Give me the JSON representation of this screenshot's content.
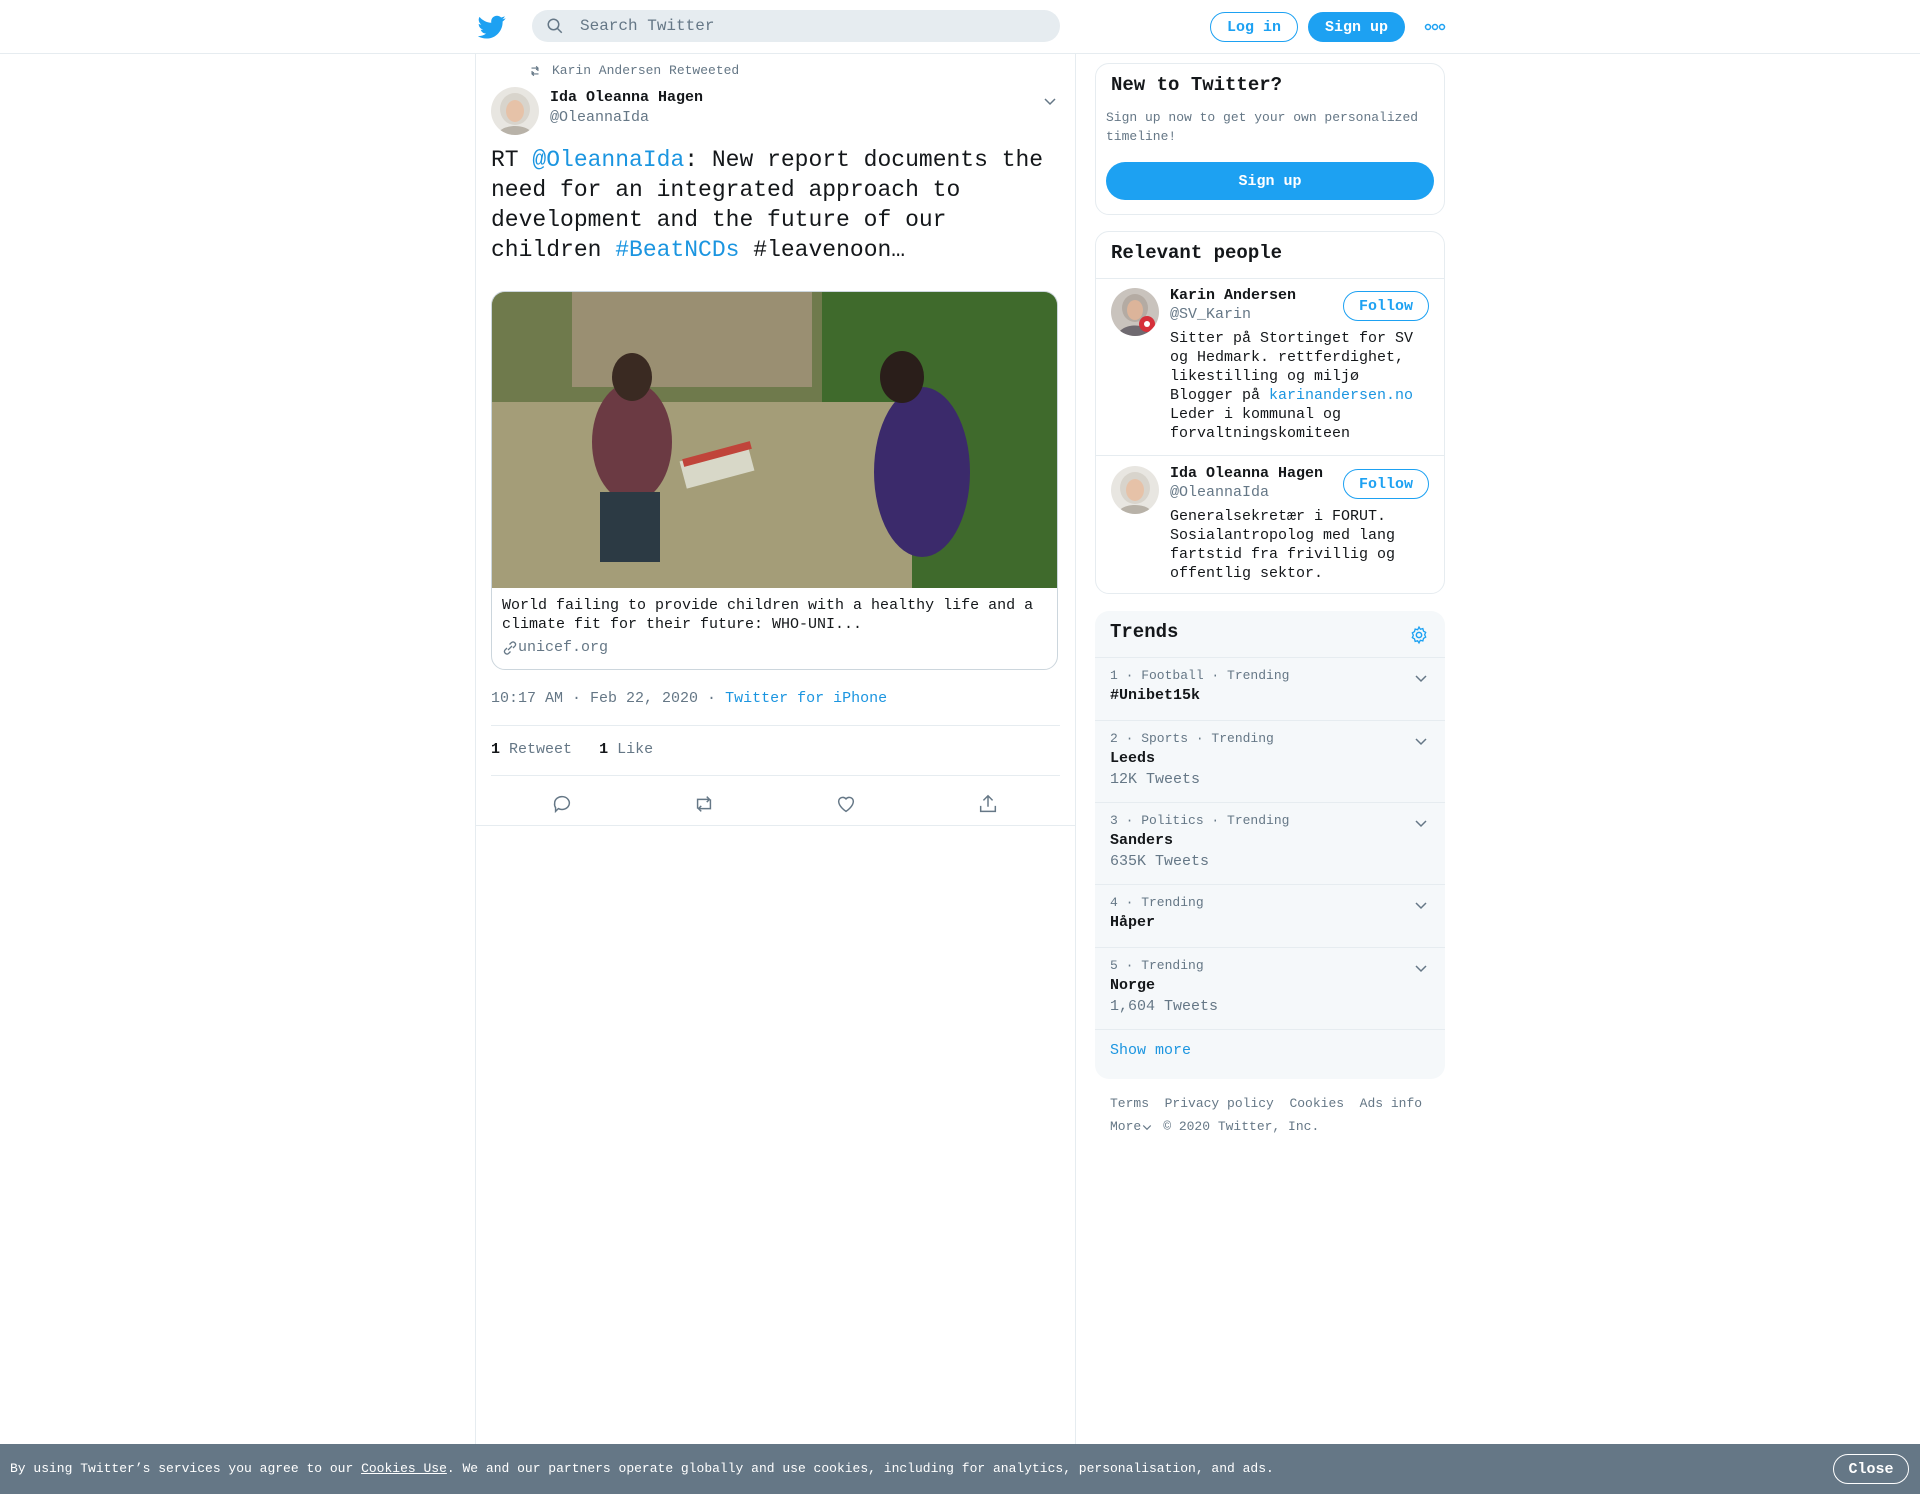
{
  "header": {
    "search_placeholder": "Search Twitter",
    "login_label": "Log in",
    "signup_label": "Sign up"
  },
  "tweet": {
    "retweeted_by": "Karin Andersen Retweeted",
    "author_name": "Ida Oleanna Hagen",
    "author_handle": "@OleannaIda",
    "text_prefix": "RT ",
    "mention": "@OleannaIda",
    "text_mid": ": New report documents the need for an integrated approach to development and the future of our children ",
    "hashtag": "#BeatNCDs",
    "text_suffix": " #leavenoon…",
    "card": {
      "description": "World failing to provide children with a healthy life and a climate fit for their future: WHO-UNI...",
      "domain": "unicef.org"
    },
    "time": "10:17 AM · Feb 22, 2020",
    "source_sep": " · ",
    "source": "Twitter for iPhone",
    "retweet_count": "1",
    "retweet_label": "Retweet",
    "like_count": "1",
    "like_label": "Like"
  },
  "sidebar": {
    "new_title": "New to Twitter?",
    "new_sub": "Sign up now to get your own personalized timeline!",
    "new_signup": "Sign up",
    "relevant_title": "Relevant people",
    "people": [
      {
        "name": "Karin Andersen",
        "handle": "@SV_Karin",
        "follow": "Follow",
        "bio_1": "Sitter på Stortinget for SV og Hedmark. rettferdighet, likestilling og miljø Blogger på ",
        "bio_link": "karinandersen.no",
        "bio_2": " Leder i kommunal og forvaltningskomiteen"
      },
      {
        "name": "Ida Oleanna Hagen",
        "handle": "@OleannaIda",
        "follow": "Follow",
        "bio_1": "Generalsekretær i FORUT. Sosialantropolog med lang fartstid fra frivillig og offentlig sektor."
      }
    ],
    "trends_title": "Trends",
    "trends": [
      {
        "meta": "1 · Football · Trending",
        "name": "#Unibet15k",
        "count": ""
      },
      {
        "meta": "2 · Sports · Trending",
        "name": "Leeds",
        "count": "12K Tweets"
      },
      {
        "meta": "3 · Politics · Trending",
        "name": "Sanders",
        "count": "635K Tweets"
      },
      {
        "meta": "4 · Trending",
        "name": "Håper",
        "count": ""
      },
      {
        "meta": "5 · Trending",
        "name": "Norge",
        "count": "1,604 Tweets"
      }
    ],
    "show_more": "Show more",
    "footer_links": [
      "Terms",
      "Privacy policy",
      "Cookies",
      "Ads info"
    ],
    "footer_more": "More",
    "copyright": "© 2020 Twitter, Inc."
  },
  "cookie": {
    "text_1": "By using Twitter’s services you agree to our ",
    "link": "Cookies Use",
    "text_2": ". We and our partners operate globally and use cookies, including for analytics, personalisation, and ads.",
    "close": "Close"
  },
  "colors": {
    "accent": "#1da1f2",
    "link": "#1b95e0",
    "secondary_text": "#657786",
    "cookie_bar": "#657786"
  }
}
